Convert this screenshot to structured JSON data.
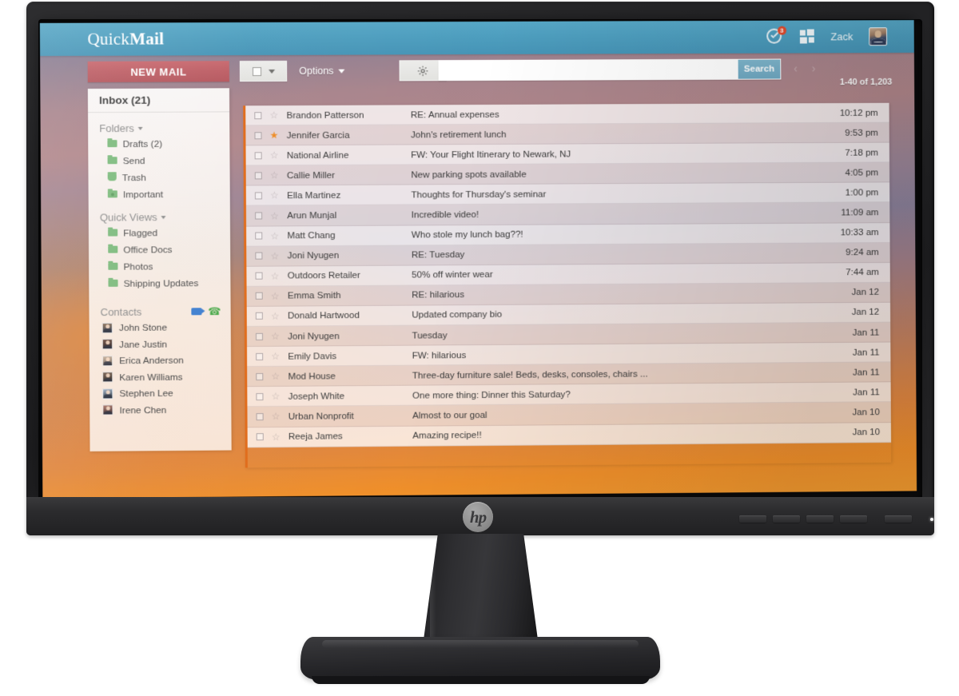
{
  "app": {
    "brand_light": "Quick",
    "brand_bold": "Mail",
    "user_name": "Zack",
    "notification_badge": "3"
  },
  "toolbar": {
    "new_mail_label": "NEW MAIL",
    "options_label": "Options",
    "search_placeholder": "",
    "search_value": "",
    "search_button_label": "Search",
    "prev_arrow": "‹",
    "next_arrow": "›",
    "pager_count": "1-40 of 1,203"
  },
  "sidebar": {
    "inbox_label": "Inbox (21)",
    "folders_label": "Folders",
    "folders": [
      {
        "label": "Drafts (2)",
        "icon": "folder-icon"
      },
      {
        "label": "Send",
        "icon": "folder-icon"
      },
      {
        "label": "Trash",
        "icon": "trash-icon"
      },
      {
        "label": "Important",
        "icon": "folder-important-icon"
      }
    ],
    "quick_views_label": "Quick Views",
    "quick_views": [
      {
        "label": "Flagged",
        "icon": "folder-icon"
      },
      {
        "label": "Office Docs",
        "icon": "folder-icon"
      },
      {
        "label": "Photos",
        "icon": "folder-icon"
      },
      {
        "label": "Shipping Updates",
        "icon": "folder-icon"
      }
    ],
    "contacts_label": "Contacts",
    "contacts": [
      {
        "name": "John Stone"
      },
      {
        "name": "Jane Justin"
      },
      {
        "name": "Erica Anderson"
      },
      {
        "name": "Karen Williams"
      },
      {
        "name": "Stephen Lee"
      },
      {
        "name": "Irene Chen"
      }
    ]
  },
  "mail_list": {
    "rows": [
      {
        "sender": "Brandon Patterson",
        "subject": "RE: Annual expenses",
        "time": "10:12 pm",
        "starred": false
      },
      {
        "sender": "Jennifer Garcia",
        "subject": "John's retirement lunch",
        "time": "9:53 pm",
        "starred": true
      },
      {
        "sender": "National Airline",
        "subject": "FW: Your Flight Itinerary to Newark, NJ",
        "time": "7:18 pm",
        "starred": false
      },
      {
        "sender": "Callie Miller",
        "subject": "New parking spots available",
        "time": "4:05 pm",
        "starred": false
      },
      {
        "sender": "Ella Martinez",
        "subject": "Thoughts for Thursday's seminar",
        "time": "1:00 pm",
        "starred": false
      },
      {
        "sender": "Arun Munjal",
        "subject": "Incredible video!",
        "time": "11:09 am",
        "starred": false
      },
      {
        "sender": "Matt Chang",
        "subject": "Who stole my lunch bag??!",
        "time": "10:33 am",
        "starred": false
      },
      {
        "sender": "Joni Nyugen",
        "subject": "RE: Tuesday",
        "time": "9:24 am",
        "starred": false
      },
      {
        "sender": "Outdoors Retailer",
        "subject": "50% off winter wear",
        "time": "7:44 am",
        "starred": false
      },
      {
        "sender": "Emma Smith",
        "subject": "RE: hilarious",
        "time": "Jan 12",
        "starred": false
      },
      {
        "sender": "Donald Hartwood",
        "subject": "Updated company bio",
        "time": "Jan 12",
        "starred": false
      },
      {
        "sender": "Joni Nyugen",
        "subject": "Tuesday",
        "time": "Jan 11",
        "starred": false
      },
      {
        "sender": "Emily Davis",
        "subject": "FW: hilarious",
        "time": "Jan 11",
        "starred": false
      },
      {
        "sender": "Mod House",
        "subject": "Three-day furniture sale! Beds, desks, consoles, chairs ...",
        "time": "Jan 11",
        "starred": false
      },
      {
        "sender": "Joseph White",
        "subject": "One more thing: Dinner this Saturday?",
        "time": "Jan 11",
        "starred": false
      },
      {
        "sender": "Urban Nonprofit",
        "subject": "Almost to our goal",
        "time": "Jan 10",
        "starred": false
      },
      {
        "sender": "Reeja James",
        "subject": "Amazing recipe!!",
        "time": "Jan 10",
        "starred": false
      }
    ],
    "star_empty": "☆",
    "star_filled": "★"
  },
  "monitor": {
    "brand_logo": "hp"
  },
  "colors": {
    "header_teal": "#4c9cbd",
    "new_mail_red": "#bc5c63",
    "accent_orange": "#e06a18",
    "folder_green": "#7cba7c",
    "star_orange": "#ee8a22",
    "badge_red": "#e24b2c",
    "search_button": "#6fa9c3"
  }
}
